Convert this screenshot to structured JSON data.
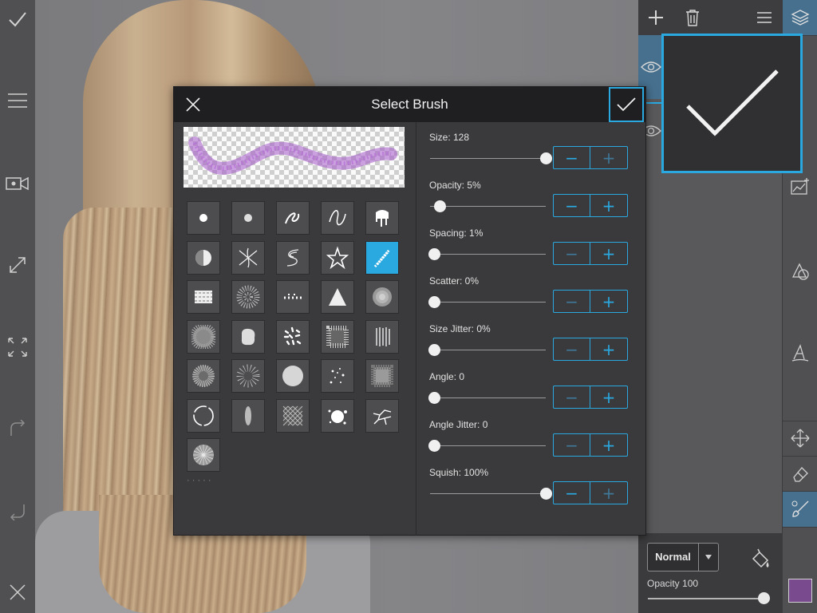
{
  "dialog": {
    "title": "Select Brush",
    "settings": [
      {
        "label": "Size: 128",
        "value": 128,
        "fraction": 1.0,
        "minus_enabled": true,
        "plus_enabled": false
      },
      {
        "label": "Opacity: 5%",
        "value": 5,
        "fraction": 0.05,
        "minus_enabled": true,
        "plus_enabled": true
      },
      {
        "label": "Spacing: 1%",
        "value": 1,
        "fraction": 0.0,
        "minus_enabled": false,
        "plus_enabled": true
      },
      {
        "label": "Scatter: 0%",
        "value": 0,
        "fraction": 0.0,
        "minus_enabled": false,
        "plus_enabled": true
      },
      {
        "label": "Size Jitter: 0%",
        "value": 0,
        "fraction": 0.0,
        "minus_enabled": false,
        "plus_enabled": true
      },
      {
        "label": "Angle: 0",
        "value": 0,
        "fraction": 0.0,
        "minus_enabled": false,
        "plus_enabled": true
      },
      {
        "label": "Angle Jitter: 0",
        "value": 0,
        "fraction": 0.0,
        "minus_enabled": false,
        "plus_enabled": true
      },
      {
        "label": "Squish: 100%",
        "value": 100,
        "fraction": 1.0,
        "minus_enabled": true,
        "plus_enabled": false
      }
    ],
    "brushes": [
      [
        "dot-hard-icon",
        "dot-soft-icon",
        "squiggle-brush-icon",
        "wave-brush-icon",
        "drip-brush-icon"
      ],
      [
        "half-circle-brush-icon",
        "cross-swirl-brush-icon",
        "s-swirl-brush-icon",
        "star-brush-icon",
        "feather-brush-icon"
      ],
      [
        "rough-stroke-brush-icon",
        "speckle-round-brush-icon",
        "dotted-line-brush-icon",
        "triangle-splatter-brush-icon",
        "airbrush-soft-icon"
      ],
      [
        "noise-disc-brush-icon",
        "sponge-brush-icon",
        "grain-scatter-brush-icon",
        "texture-square-brush-icon",
        "hatch-lines-brush-icon"
      ],
      [
        "noise-round-brush-icon",
        "fine-speckle-brush-icon",
        "flat-disc-brush-icon",
        "star-scatter-brush-icon",
        "rough-square-brush-icon"
      ],
      [
        "ring-brush-icon",
        "ellipse-brush-icon",
        "crosshatch-brush-icon",
        "splat-brush-icon",
        "crack-brush-icon"
      ],
      [
        "radial-lines-brush-icon"
      ]
    ],
    "selected_brush": "feather-brush-icon"
  },
  "blend": {
    "mode": "Normal",
    "opacity_label": "Opacity 100",
    "opacity_fraction": 1.0
  },
  "colors": {
    "accent": "#2aa9e0",
    "brush_preview": "#a455c9",
    "current_color": "#7a4a8e"
  },
  "left_toolbar": [
    "checkmark-icon",
    "menu-icon",
    "video-record-icon",
    "resize-icon",
    "fullscreen-icon",
    "redo-icon",
    "undo-icon",
    "close-icon"
  ],
  "layers_header": [
    "add-layer-icon",
    "trash-icon",
    "menu-icon"
  ],
  "right_toolbar": [
    "layers-icon",
    "add-image-icon",
    "shapes-icon",
    "text-icon",
    "move-icon",
    "eraser-icon",
    "brush-icon"
  ]
}
